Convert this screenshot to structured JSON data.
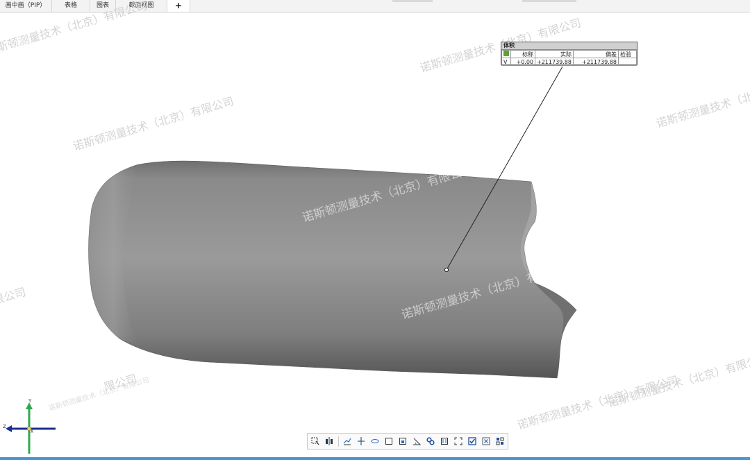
{
  "tabs": [
    {
      "label": "画中画（PIP）"
    },
    {
      "label": "表格"
    },
    {
      "label": "图表"
    },
    {
      "label": "截面视图"
    },
    {
      "label": "+"
    }
  ],
  "callout": {
    "title": "体积",
    "headers": [
      "",
      "标称",
      "实际",
      "偏差",
      "检验"
    ],
    "row": {
      "label": "V",
      "nominal": "+0.00",
      "actual": "+211739.88",
      "deviation": "+211739.88",
      "check": ""
    }
  },
  "watermarks": [
    "诺斯顿测量技术（北京）有限公司",
    "诺斯顿测量技术（北京）有限公司",
    "限公司",
    "限公司",
    "诺斯顿测量技术（北京）有限公司",
    "诺斯顿测量技术（北京）有限公司",
    "诺斯顿测量技术（北京）有限公司",
    "诺斯顿测量技术（北京）有限公司",
    "诺斯顿测量技术（北京）有限公司",
    "诺斯顿测量技术（北京）有限公司",
    "诺斯顿测量技术（北京）有限公司"
  ],
  "axes": {
    "y": "Y",
    "z": "Z",
    "x": "X"
  },
  "toolbar_icons": [
    "select-icon",
    "section-icon",
    "align-icon",
    "plane-icon",
    "ruler-icon",
    "square-icon",
    "box-icon",
    "angle-icon",
    "link-icon",
    "fit-icon",
    "frame-icon",
    "check-icon",
    "delete-icon",
    "grid-icon"
  ],
  "colors": {
    "tab_bg": "#f3f3f3",
    "accent": "#4f94d4",
    "model": "#8a8a8a",
    "axis_y": "#2fa84f",
    "axis_z": "#1b2f8f"
  }
}
